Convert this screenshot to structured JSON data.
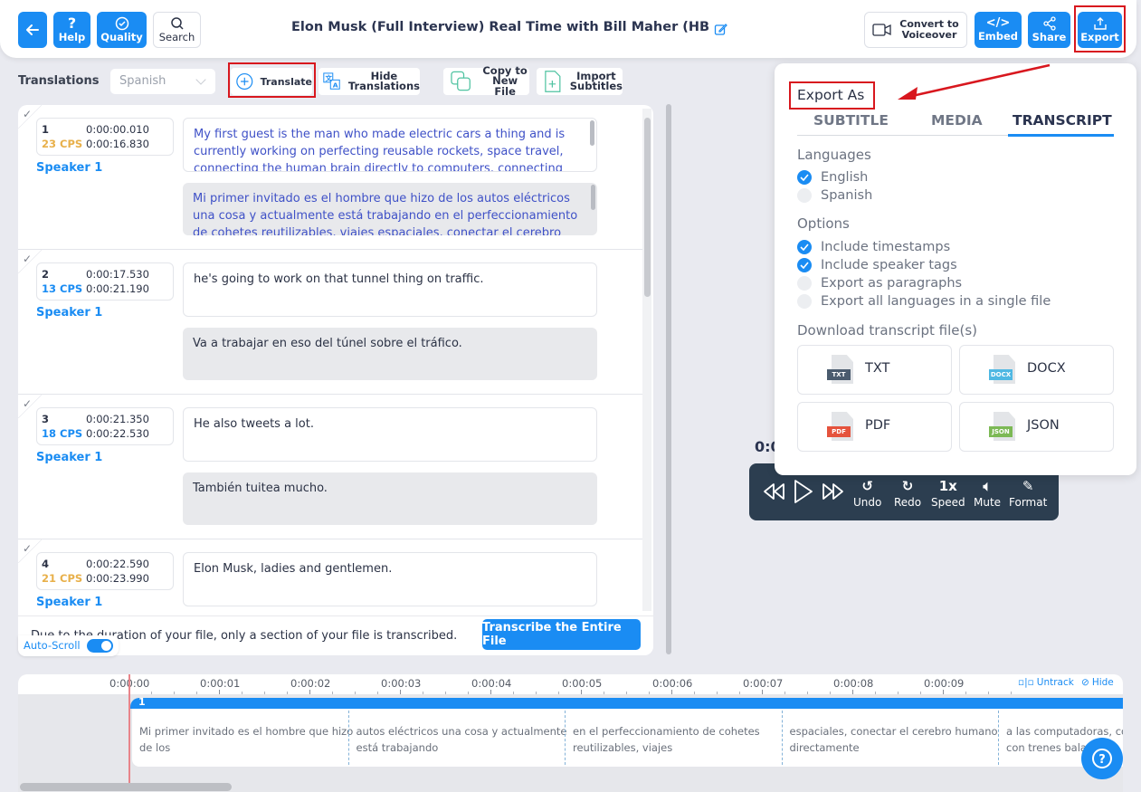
{
  "header": {
    "title": "Elon Musk (Full Interview) Real Time with Bill Maher (HBO) cc",
    "back_icon": "arrow-left-icon",
    "help_label": "Help",
    "quality_label": "Quality",
    "search_label": "Search",
    "convert_label_1": "Convert to",
    "convert_label_2": "Voiceover",
    "embed_label": "Embed",
    "share_label": "Share",
    "export_label": "Export"
  },
  "toolbar": {
    "translations_label": "Translations",
    "language_selected": "Spanish",
    "translate_label": "Translate",
    "hide_label_1": "Hide",
    "hide_label_2": "Translations",
    "copy_label_1": "Copy to",
    "copy_label_2": "New File",
    "import_label_1": "Import",
    "import_label_2": "Subtitles"
  },
  "segments": [
    {
      "index": "1",
      "cps": "23 CPS",
      "cps_color": "#e8b04a",
      "start": "0:00:00.010",
      "end": "0:00:16.830",
      "speaker": "Speaker 1",
      "source": "My first guest is the man who made electric cars a thing and is currently working on perfecting reusable rockets, space travel, connecting the human brain directly to computers, connecting",
      "translation": "Mi primer invitado es el hombre que hizo de los autos eléctricos una cosa y actualmente está trabajando en el perfeccionamiento de cohetes reutilizables, viajes espaciales, conectar el cerebro"
    },
    {
      "index": "2",
      "cps": "13 CPS",
      "cps_color": "#1a8cf3",
      "start": "0:00:17.530",
      "end": "0:00:21.190",
      "speaker": "Speaker 1",
      "source": "he's going to work on that tunnel thing on traffic.",
      "translation": "Va a trabajar en eso del túnel sobre el tráfico."
    },
    {
      "index": "3",
      "cps": "18 CPS",
      "cps_color": "#1a8cf3",
      "start": "0:00:21.350",
      "end": "0:00:22.530",
      "speaker": "Speaker 1",
      "source": "He also tweets a lot.",
      "translation": "También tuitea mucho."
    },
    {
      "index": "4",
      "cps": "21 CPS",
      "cps_color": "#e8b04a",
      "start": "0:00:22.590",
      "end": "0:00:23.990",
      "speaker": "Speaker 1",
      "source": "Elon Musk, ladies and gentlemen.",
      "translation": ""
    }
  ],
  "footer": {
    "note": "Due to the duration of your file, only a section of your file is transcribed.",
    "transcribe_label": "Transcribe the Entire File",
    "autoscroll_label": "Auto-Scroll",
    "autoscroll_on": true
  },
  "player": {
    "time": "0:0",
    "speed": "1x",
    "undo": "Undo",
    "redo": "Redo",
    "speed_label": "Speed",
    "mute": "Mute",
    "format": "Format"
  },
  "export_panel": {
    "title": "Export As",
    "tabs": [
      "SUBTITLE",
      "MEDIA",
      "TRANSCRIPT"
    ],
    "active_tab": "TRANSCRIPT",
    "languages_label": "Languages",
    "languages": [
      {
        "label": "English",
        "checked": true
      },
      {
        "label": "Spanish",
        "checked": false
      }
    ],
    "options_label": "Options",
    "options": [
      {
        "label": "Include timestamps",
        "checked": true
      },
      {
        "label": "Include speaker tags",
        "checked": true
      },
      {
        "label": "Export as paragraphs",
        "checked": false
      },
      {
        "label": "Export all languages in a single file",
        "checked": false
      }
    ],
    "download_label": "Download transcript file(s)",
    "formats": [
      {
        "label": "TXT",
        "tag": "TXT",
        "color": "#4a5b6e"
      },
      {
        "label": "DOCX",
        "tag": "DOCX",
        "color": "#4fb8e3"
      },
      {
        "label": "PDF",
        "tag": "PDF",
        "color": "#e5533d"
      },
      {
        "label": "JSON",
        "tag": "JSON",
        "color": "#7cb955"
      }
    ]
  },
  "timeline": {
    "ticks": [
      "0:00:00",
      "0:00:01",
      "0:00:02",
      "0:00:03",
      "0:00:04",
      "0:00:05",
      "0:00:06",
      "0:00:07",
      "0:00:08",
      "0:00:09"
    ],
    "untrack_label": "Untrack",
    "hide_label": "Hide",
    "segment_index": "1",
    "captions": [
      [
        "Mi primer invitado es el hombre que hizo",
        "de los"
      ],
      [
        "autos eléctricos una cosa y actualmente",
        "está trabajando"
      ],
      [
        "en el perfeccionamiento de cohetes",
        "reutilizables, viajes"
      ],
      [
        "espaciales, conectar el cerebro humano",
        "directamente"
      ],
      [
        "a las computadoras, con",
        "con trenes bala"
      ]
    ]
  },
  "colors": {
    "accent": "#1a8cf3",
    "annotation_red": "#d8171e",
    "player_bg": "#2c3e50"
  }
}
